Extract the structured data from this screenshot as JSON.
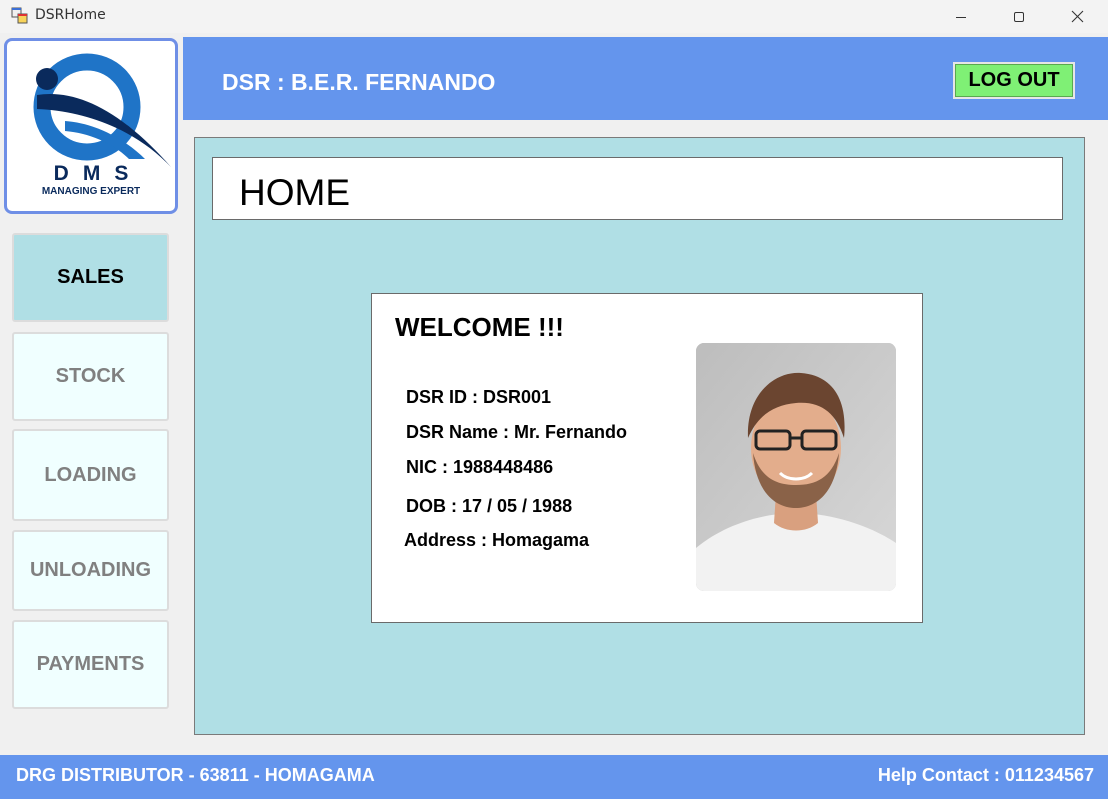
{
  "window": {
    "title": "DSRHome",
    "app_icon": "windows-forms-app-icon",
    "controls": [
      "minimize-icon",
      "maximize-icon",
      "close-icon"
    ]
  },
  "logo": {
    "name": "DMS",
    "tagline": "MANAGING EXPERT"
  },
  "header": {
    "user_label": "DSR : B.E.R. FERNANDO",
    "logout_label": "LOG OUT"
  },
  "nav": {
    "items": [
      {
        "label": "SALES",
        "active": true
      },
      {
        "label": "STOCK",
        "active": false
      },
      {
        "label": "LOADING",
        "active": false
      },
      {
        "label": "UNLOADING",
        "active": false
      },
      {
        "label": "PAYMENTS",
        "active": false
      }
    ]
  },
  "main": {
    "page_title": "HOME",
    "welcome": {
      "title": "WELCOME !!!",
      "dsr_id": "DSR ID : DSR001",
      "dsr_name": "DSR Name : Mr. Fernando",
      "nic": "NIC : 1988448486",
      "dob": "DOB : 17 / 05 / 1988",
      "address": "Address : Homagama",
      "photo": "profile-photo"
    }
  },
  "footer": {
    "left": "DRG DISTRIBUTOR - 63811 - HOMAGAMA",
    "right": "Help  Contact : 011234567"
  },
  "colors": {
    "accent_blue": "#6495ed",
    "panel_teal": "#b0dfe5",
    "nav_inactive": "#f0ffff",
    "logout_green": "#7ff075"
  }
}
